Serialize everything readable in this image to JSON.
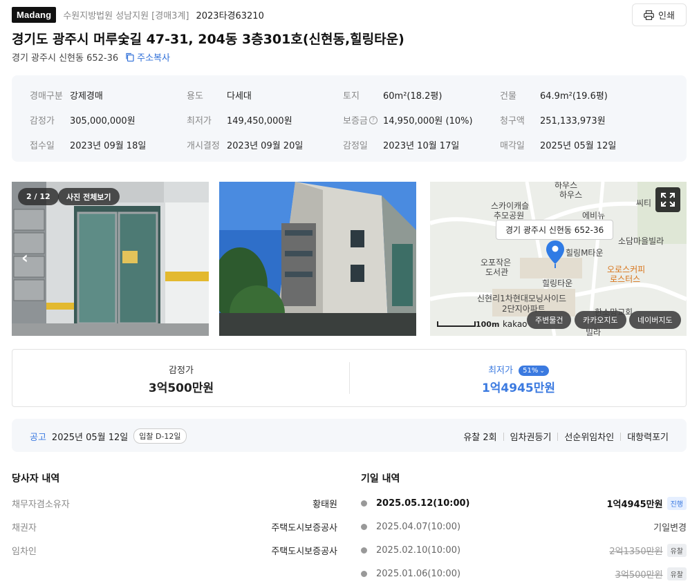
{
  "header": {
    "brand": "Madang",
    "court": "수원지방법원 성남지원 [경매3계]",
    "case_number": "2023타경63210",
    "print_label": "인쇄"
  },
  "property": {
    "title": "경기도 광주시 머루숯길 47-31, 204동 3층301호(신현동,힐링타운)",
    "lot_address": "경기 광주시 신현동 652-36",
    "copy_label": "주소복사"
  },
  "info": {
    "auction_type": {
      "label": "경매구분",
      "value": "강제경매"
    },
    "usage": {
      "label": "용도",
      "value": "다세대"
    },
    "land": {
      "label": "토지",
      "value": "60m²(18.2평)"
    },
    "building": {
      "label": "건물",
      "value": "64.9m²(19.6평)"
    },
    "appraisal": {
      "label": "감정가",
      "value": "305,000,000원"
    },
    "min_price": {
      "label": "최저가",
      "value": "149,450,000원"
    },
    "deposit": {
      "label": "보증금",
      "value": "14,950,000원 (10%)"
    },
    "claim": {
      "label": "청구액",
      "value": "251,133,973원"
    },
    "received": {
      "label": "접수일",
      "value": "2023년 09월 18일"
    },
    "commence": {
      "label": "개시결정",
      "value": "2023년 09월 20일"
    },
    "appraisal_date": {
      "label": "감정일",
      "value": "2023년 10월 17일"
    },
    "sale_date": {
      "label": "매각일",
      "value": "2025년 05월 12일"
    }
  },
  "gallery": {
    "counter": "2 / 12",
    "view_all": "사진 전체보기"
  },
  "map": {
    "tooltip": "경기 광주시 신현동 652-36",
    "labels": [
      "하우스",
      "스카이캐슬",
      "추모공원",
      "에비뉴",
      "씨티",
      "소담마을빌라",
      "힐링M타운",
      "오포작은",
      "도서관",
      "오로스커피",
      "로스터스",
      "힐링타운",
      "신현리1차현대모닝사이드",
      "2단지아파트",
      "한소망교회",
      "빌라"
    ],
    "scale": "100m",
    "provider": "kakao",
    "buttons": {
      "nearby": "주변물건",
      "kakao": "카카오지도",
      "naver": "네이버지도"
    }
  },
  "price": {
    "appraisal_label": "감정가",
    "appraisal_value": "3억500만원",
    "min_label": "최저가",
    "min_pct": "51%",
    "min_value": "1억4945만원"
  },
  "notice": {
    "label": "공고",
    "date": "2025년 05월 12일",
    "dday": "입찰 D-12일",
    "tags": [
      "유찰 2회",
      "임차권등기",
      "선순위임차인",
      "대항력포기"
    ]
  },
  "parties": {
    "title": "당사자 내역",
    "rows": [
      {
        "k": "채무자겸소유자",
        "v": "황태원"
      },
      {
        "k": "채권자",
        "v": "주택도시보증공사"
      },
      {
        "k": "임차인",
        "v": "주택도시보증공사"
      }
    ]
  },
  "schedule": {
    "title": "기일 내역",
    "rows": [
      {
        "date": "2025.05.12(10:00)",
        "result": "1억4945만원",
        "tag": "진행"
      },
      {
        "date": "2025.04.07(10:00)",
        "result": "기일변경",
        "tag": ""
      },
      {
        "date": "2025.02.10(10:00)",
        "result": "2억1350만원",
        "tag": "유찰"
      },
      {
        "date": "2025.01.06(10:00)",
        "result": "3억500만원",
        "tag": "유찰"
      }
    ]
  },
  "colors": {
    "accent": "#3b7ae0",
    "brand_bg": "#111111"
  }
}
